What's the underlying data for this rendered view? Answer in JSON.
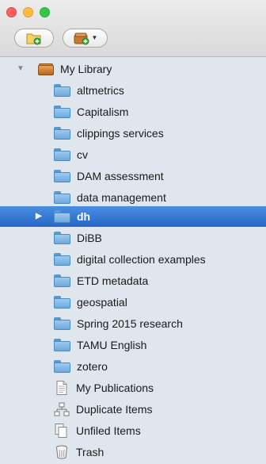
{
  "window": {
    "toolbar": {
      "new_collection_icon": "new-collection-icon",
      "new_library_icon": "new-library-icon"
    }
  },
  "library": {
    "label": "My Library",
    "collections": [
      {
        "label": "altmetrics"
      },
      {
        "label": "Capitalism"
      },
      {
        "label": "clippings services"
      },
      {
        "label": "cv"
      },
      {
        "label": "DAM assessment"
      },
      {
        "label": "data management"
      },
      {
        "label": "dh",
        "selected": true
      },
      {
        "label": "DiBB"
      },
      {
        "label": "digital collection examples"
      },
      {
        "label": "ETD metadata"
      },
      {
        "label": "geospatial"
      },
      {
        "label": "Spring 2015 research"
      },
      {
        "label": "TAMU English"
      },
      {
        "label": "zotero"
      }
    ],
    "special": [
      {
        "label": "My Publications",
        "icon": "document-icon"
      },
      {
        "label": "Duplicate Items",
        "icon": "duplicate-items-icon"
      },
      {
        "label": "Unfiled Items",
        "icon": "unfiled-items-icon"
      },
      {
        "label": "Trash",
        "icon": "trash-icon"
      }
    ]
  },
  "colors": {
    "sidebar_bg": "#dfe6ee",
    "selection": "#2f74d0",
    "folder": "#7fb3e3"
  }
}
